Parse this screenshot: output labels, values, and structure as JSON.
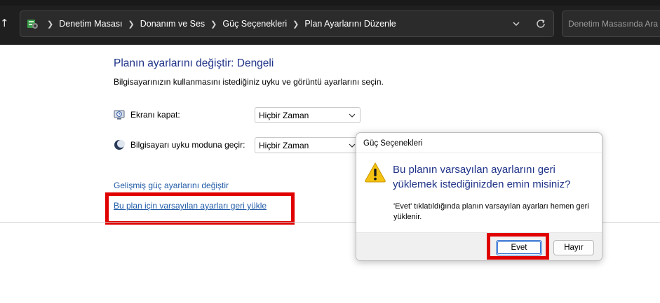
{
  "address_bar": {
    "breadcrumbs": [
      "Denetim Masası",
      "Donanım ve Ses",
      "Güç Seçenekleri",
      "Plan Ayarlarını Düzenle"
    ],
    "search_placeholder": "Denetim Masasında Ara"
  },
  "main": {
    "title": "Planın ayarlarını değiştir: Dengeli",
    "subtitle": "Bilgisayarınızın kullanmasını istediğiniz uyku ve görüntü ayarlarını seçin.",
    "display_off": {
      "label": "Ekranı kapat:",
      "value": "Hiçbir Zaman"
    },
    "sleep": {
      "label": "Bilgisayarı uyku moduna geçir:",
      "value": "Hiçbir Zaman"
    },
    "advanced_link": "Gelişmiş güç ayarlarını değiştir",
    "restore_link": "Bu plan için varsayılan ayarları geri yükle"
  },
  "dialog": {
    "title": "Güç Seçenekleri",
    "question": "Bu planın varsayılan ayarlarını geri yüklemek istediğinizden emin misiniz?",
    "detail": "'Evet' tıklatıldığında planın varsayılan ayarları hemen geri yüklenir.",
    "yes_label": "Evet",
    "no_label": "Hayır"
  },
  "colors": {
    "title_blue": "#1e3287",
    "link_blue": "#1f5aa6",
    "highlight_red": "#e00000",
    "address_bar_bg": "#1f1f1f"
  },
  "icons": {
    "up": "up-arrow-icon",
    "control_panel": "control-panel-icon",
    "dropdown": "chevron-down-icon",
    "refresh": "refresh-icon",
    "display": "display-timer-icon",
    "sleep": "moon-icon",
    "warning": "warning-icon"
  }
}
